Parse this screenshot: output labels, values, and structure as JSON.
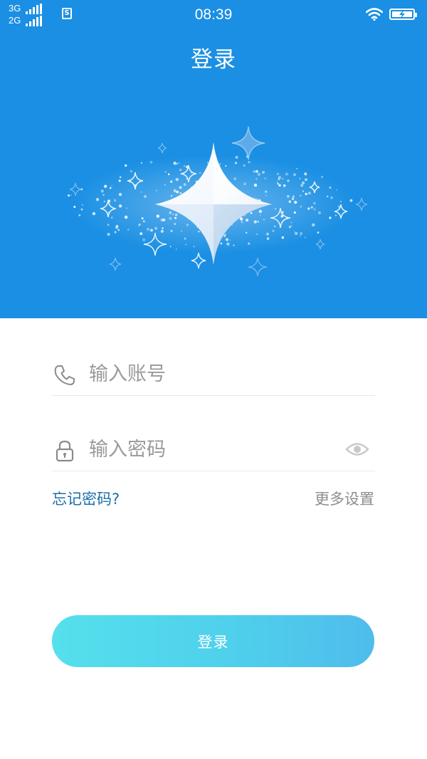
{
  "status_bar": {
    "network_1": "3G",
    "network_2": "2G",
    "sim_label": "S",
    "time": "08:39"
  },
  "header": {
    "title": "登录"
  },
  "form": {
    "account_placeholder": "输入账号",
    "password_placeholder": "输入密码",
    "forgot_password": "忘记密码?",
    "more_settings": "更多设置",
    "login_button": "登录"
  },
  "colors": {
    "header_bg": "#1a8fe3",
    "link": "#1b6fa9",
    "button_gradient_start": "#55e0ec",
    "button_gradient_end": "#4fbcec"
  },
  "icons": {
    "account": "phone-icon",
    "password": "lock-icon",
    "toggle": "eye-icon",
    "hero": "sparkle-star-icon"
  }
}
